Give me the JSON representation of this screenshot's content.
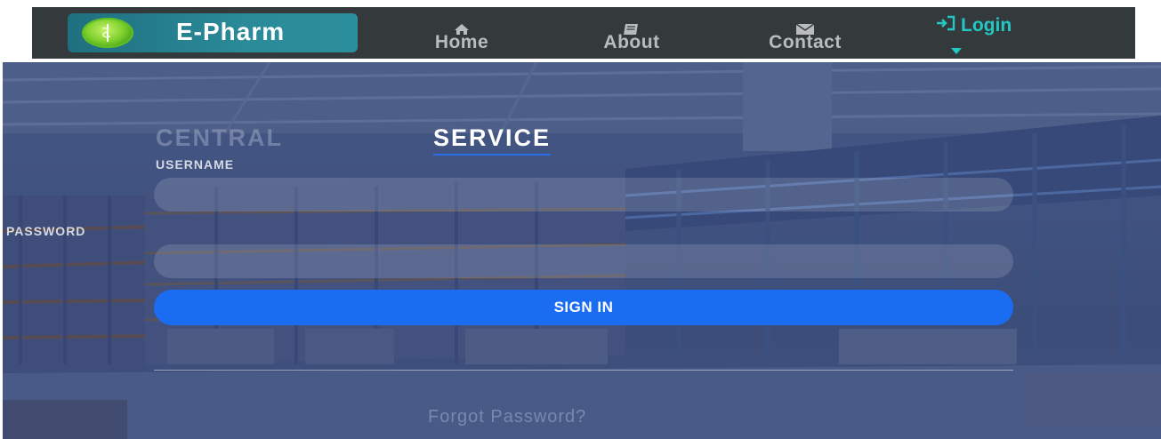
{
  "navbar": {
    "brand_name": "E-Pharm",
    "items": [
      {
        "label": "Home",
        "icon": "home-icon"
      },
      {
        "label": "About",
        "icon": "book-icon"
      },
      {
        "label": "Contact",
        "icon": "envelope-icon"
      }
    ],
    "login": {
      "label": "Login",
      "icon": "sign-in-icon"
    }
  },
  "form": {
    "tabs": {
      "central": "CENTRAL",
      "service": "SERVICE"
    },
    "active_tab": "SERVICE",
    "username_label": "USERNAME",
    "username_value": "",
    "password_label": "PASSWORD",
    "password_value": "",
    "signin_label": "SIGN IN",
    "forgot_label": "Forgot Password?"
  },
  "colors": {
    "navbar_bg": "#343a3c",
    "brand_bg": "#2a8a98",
    "login_accent": "#22c9c4",
    "signin_button": "#1a6cf0",
    "active_tab_underline": "#2a6de5"
  }
}
